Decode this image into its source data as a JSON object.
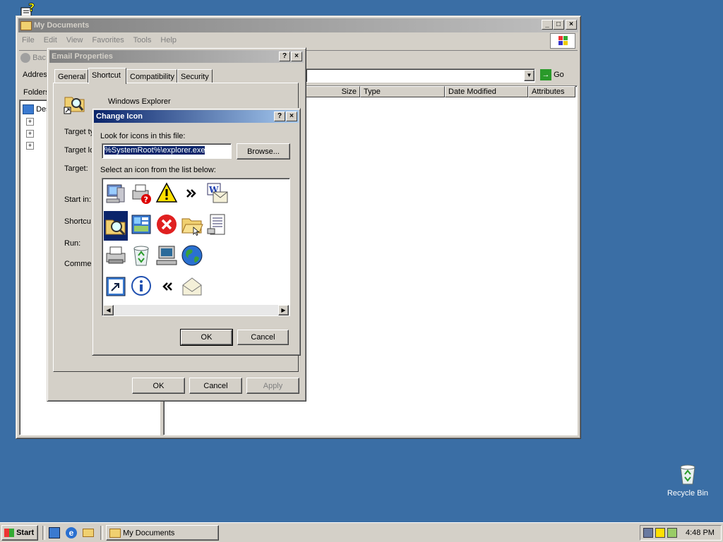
{
  "desktop": {
    "recycle_bin_label": "Recycle Bin"
  },
  "my_documents": {
    "title": "My Documents",
    "menu": [
      "File",
      "Edit",
      "View",
      "Favorites",
      "Tools",
      "Help"
    ],
    "back_label": "Bac",
    "address_label": "Addres",
    "go_label": "Go",
    "folders_label": "Folders",
    "tree_root": "Des",
    "columns": [
      "Size",
      "Type",
      "Date Modified",
      "Attributes"
    ]
  },
  "email_properties": {
    "title": "Email Properties",
    "tabs": [
      "General",
      "Shortcut",
      "Compatibility",
      "Security"
    ],
    "app_name": "Windows Explorer",
    "fields": [
      "Target ty",
      "Target lo",
      "Target:",
      "Start in:",
      "Shortcu",
      "Run:",
      "Commer"
    ],
    "ok_label": "OK",
    "cancel_label": "Cancel",
    "apply_label": "Apply"
  },
  "change_icon": {
    "title": "Change Icon",
    "look_label": "Look for icons in this file:",
    "file_value": "%SystemRoot%\\explorer.exe",
    "browse_label": "Browse...",
    "select_label": "Select an icon from the list below:",
    "ok_label": "OK",
    "cancel_label": "Cancel",
    "icons": [
      "computer-icon",
      "printer-help-icon",
      "warning-icon",
      "double-chevron-right-icon",
      "word-mail-icon",
      "folder-search-icon",
      "control-panel-icon",
      "error-icon",
      "folder-open-icon",
      "document-list-icon",
      "printer-icon",
      "recycle-bin-icon",
      "monitor-icon",
      "globe-icon",
      "shortcut-icon",
      "info-icon",
      "double-chevron-left-icon",
      "envelope-icon"
    ]
  },
  "taskbar": {
    "start_label": "Start",
    "task_label": "My Documents",
    "clock": "4:48 PM"
  },
  "colors": {
    "desktop": "#3a6ea5",
    "title_active": "#0a246a",
    "face": "#d4d0c8"
  }
}
